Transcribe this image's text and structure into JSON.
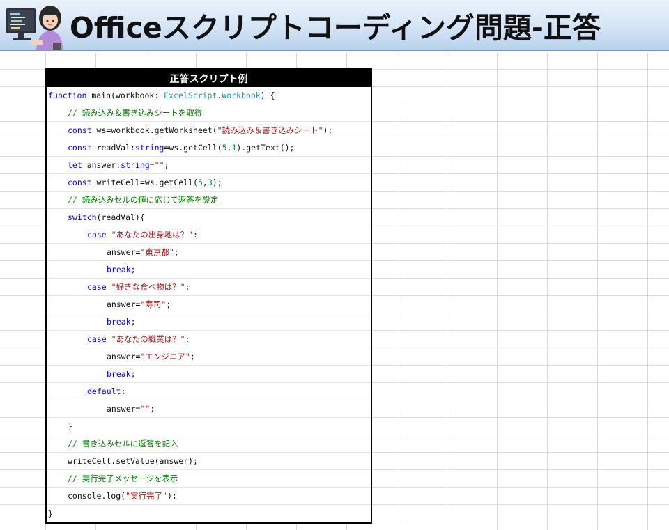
{
  "header": {
    "title": "Officeスクリプトコーディング問題-正答",
    "avatar_icon": "person-at-computer-icon"
  },
  "code_table": {
    "heading": "正答スクリプト例"
  },
  "code": {
    "l1": {
      "a": "function",
      "b": " main(workbook: ",
      "c": "ExcelScript",
      "d": ".",
      "e": "Workbook",
      "f": ") {"
    },
    "l2": {
      "a": "// 読み込み＆書き込みシートを取得"
    },
    "l3": {
      "a": "const",
      "b": " ws=workbook.getWorksheet(",
      "c": "\"読み込み＆書き込みシート\"",
      "d": ");"
    },
    "l4": {
      "a": "const",
      "b": " readVal:",
      "c": "string",
      "d": "=ws.getCell(",
      "e": "5",
      "f": ",",
      "g": "1",
      "h": ").getText();"
    },
    "l5": {
      "a": "let",
      "b": " answer:",
      "c": "string",
      "d": "=",
      "e": "\"\"",
      "f": ";"
    },
    "l6": {
      "a": "const",
      "b": " writeCell=ws.getCell(",
      "c": "5",
      "d": ",",
      "e": "3",
      "f": ");"
    },
    "l7": {
      "a": "// 読み込みセルの値に応じて返答を設定"
    },
    "l8": {
      "a": "switch",
      "b": "(readVal){"
    },
    "l9": {
      "a": "case",
      "b": " ",
      "c": "\"あなたの出身地は？\"",
      "d": ":"
    },
    "l10": {
      "a": "answer=",
      "b": "\"東京都\"",
      "c": ";"
    },
    "l11": {
      "a": "break",
      "b": ";"
    },
    "l12": {
      "a": "case",
      "b": " ",
      "c": "\"好きな食べ物は？\"",
      "d": ":"
    },
    "l13": {
      "a": "answer=",
      "b": "\"寿司\"",
      "c": ";"
    },
    "l14": {
      "a": "break",
      "b": ";"
    },
    "l15": {
      "a": "case",
      "b": " ",
      "c": "\"あなたの職業は？\"",
      "d": ":"
    },
    "l16": {
      "a": "answer=",
      "b": "\"エンジニア\"",
      "c": ";"
    },
    "l17": {
      "a": "break",
      "b": ";"
    },
    "l18": {
      "a": "default",
      "b": ":"
    },
    "l19": {
      "a": "answer=",
      "b": "\"\"",
      "c": ";"
    },
    "l20": {
      "a": "}"
    },
    "l21": {
      "a": "// 書き込みセルに返答を記入"
    },
    "l22": {
      "a": "writeCell.setValue(answer);"
    },
    "l23": {
      "a": "// 実行完了メッセージを表示"
    },
    "l24": {
      "a": "console.log(",
      "b": "\"実行完了\"",
      "c": ");"
    },
    "l25": {
      "a": "}"
    }
  },
  "colors": {
    "keyword": "#0000ff",
    "type": "#2b91af",
    "string": "#a31515",
    "number": "#098658",
    "comment": "#008000"
  }
}
